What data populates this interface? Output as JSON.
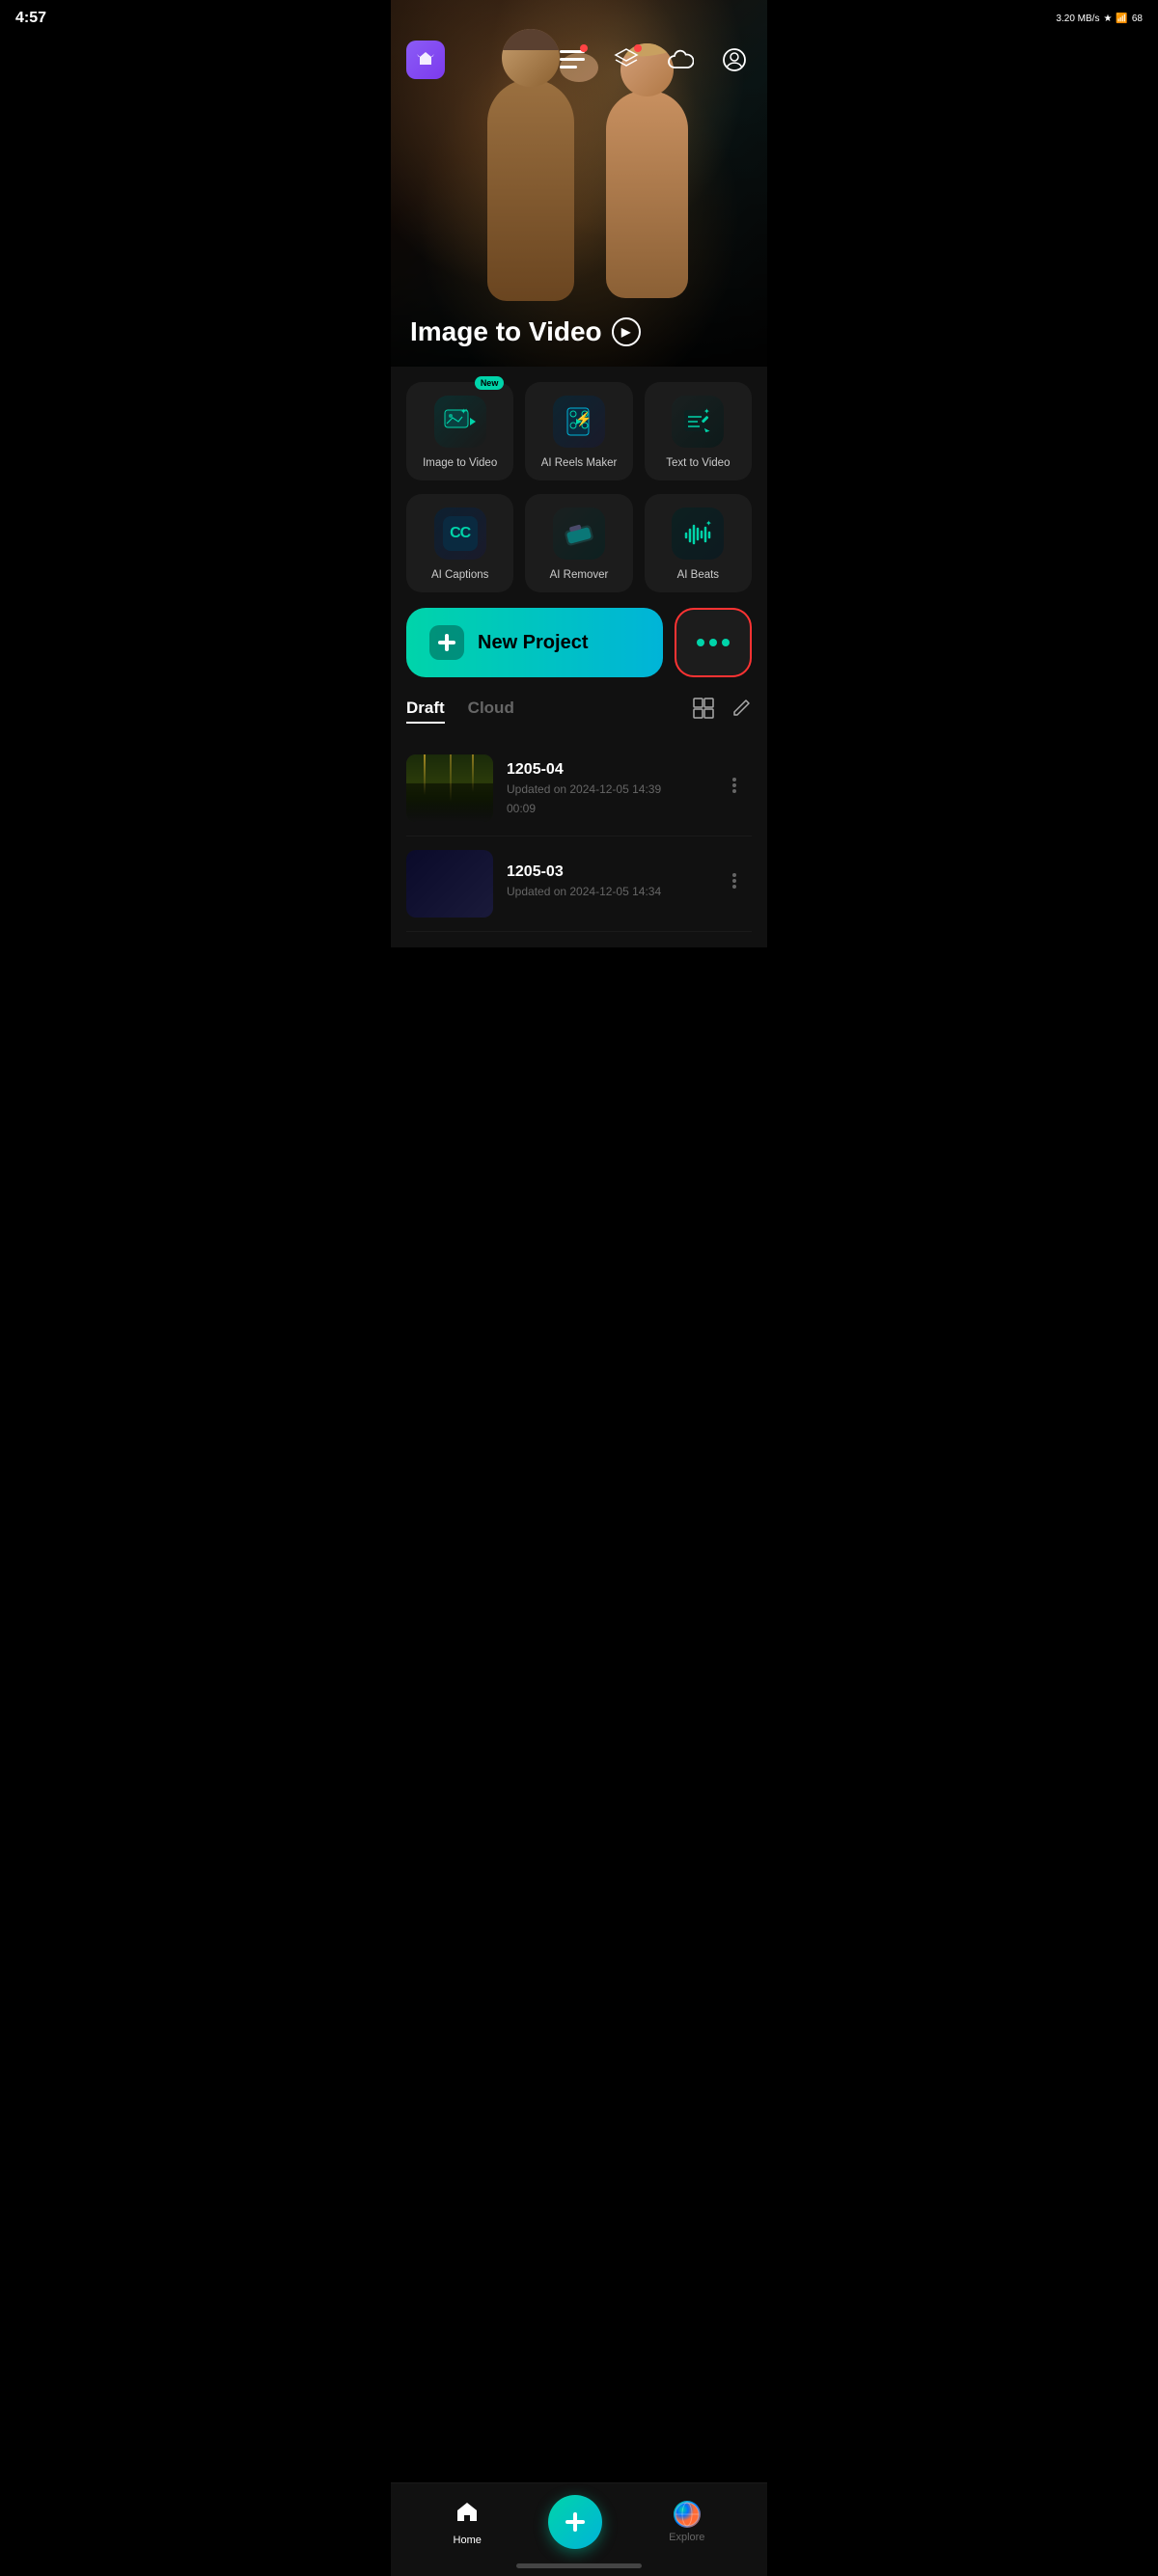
{
  "statusBar": {
    "time": "4:57",
    "network": "3.20 MB/s",
    "battery": "68"
  },
  "hero": {
    "title": "Image to Video",
    "playIcon": "▶"
  },
  "features": [
    {
      "id": "image-to-video",
      "label": "Image to Video",
      "isNew": true,
      "icon": "🎬",
      "iconClass": "icon-img-video"
    },
    {
      "id": "ai-reels-maker",
      "label": "AI Reels Maker",
      "isNew": false,
      "icon": "⚡",
      "iconClass": "icon-ai-reels"
    },
    {
      "id": "text-to-video",
      "label": "Text to Video",
      "isNew": false,
      "icon": "✏️",
      "iconClass": "icon-text-video"
    },
    {
      "id": "ai-captions",
      "label": "AI Captions",
      "isNew": false,
      "icon": "CC",
      "iconClass": "icon-ai-captions"
    },
    {
      "id": "ai-remover",
      "label": "AI Remover",
      "isNew": false,
      "icon": "🧹",
      "iconClass": "icon-ai-remover"
    },
    {
      "id": "ai-beats",
      "label": "AI Beats",
      "isNew": false,
      "icon": "🎵",
      "iconClass": "icon-ai-beats"
    }
  ],
  "newBadgeText": "New",
  "newProjectLabel": "New Project",
  "moreBtnLabel": "•••",
  "tabs": [
    {
      "id": "draft",
      "label": "Draft",
      "active": true
    },
    {
      "id": "cloud",
      "label": "Cloud",
      "active": false
    }
  ],
  "drafts": [
    {
      "id": "draft-1",
      "name": "1205-04",
      "date": "Updated on 2024-12-05 14:39",
      "duration": "00:09"
    },
    {
      "id": "draft-2",
      "name": "1205-03",
      "date": "Updated on 2024-12-05 14:34",
      "duration": ""
    }
  ],
  "nav": {
    "home": {
      "label": "Home",
      "active": true
    },
    "explore": {
      "label": "Explore",
      "active": false
    }
  }
}
